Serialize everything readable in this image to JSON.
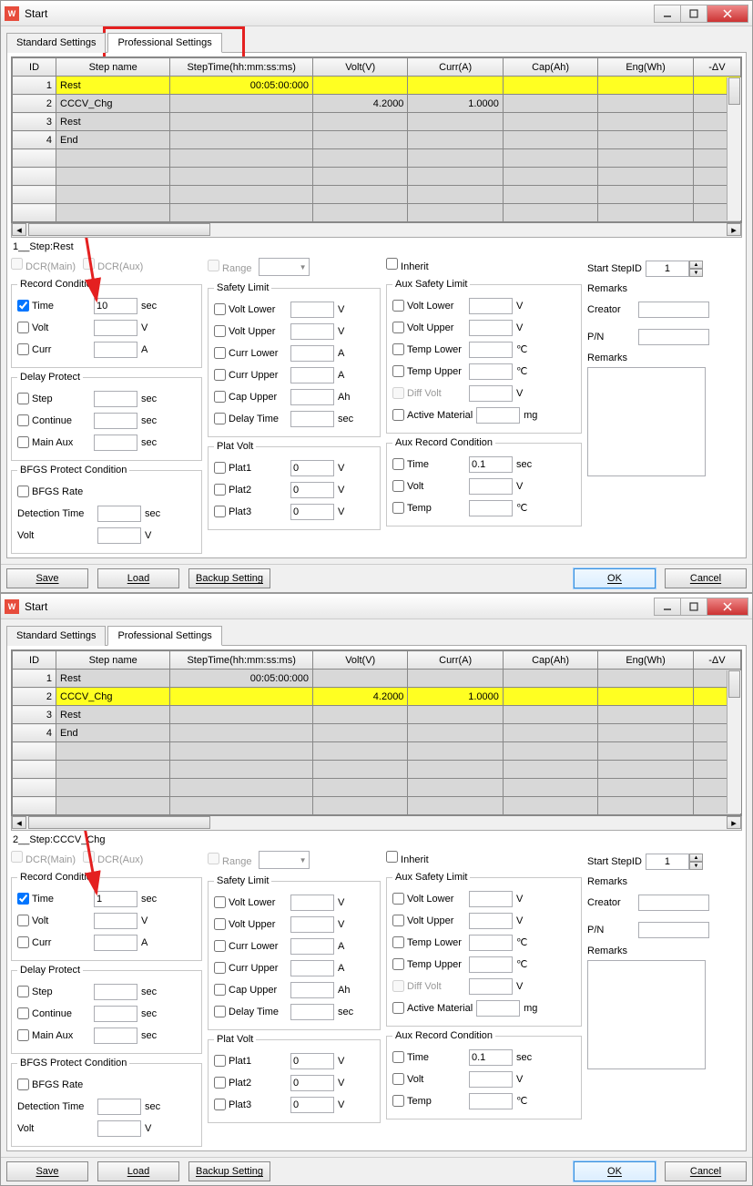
{
  "windows": [
    {
      "title": "Start",
      "tabs": {
        "standard": "Standard Settings",
        "professional": "Professional Settings",
        "active": "professional"
      },
      "highlightTab": true,
      "arrowTo": "time",
      "grid": {
        "headers": [
          "ID",
          "Step name",
          "StepTime(hh:mm:ss:ms)",
          "Volt(V)",
          "Curr(A)",
          "Cap(Ah)",
          "Eng(Wh)",
          "-ΔV"
        ],
        "rows": [
          {
            "id": "1",
            "name": "Rest",
            "time": "00:05:00:000",
            "volt": "",
            "curr": "",
            "cap": "",
            "eng": "",
            "dv": "",
            "sel": true
          },
          {
            "id": "2",
            "name": "CCCV_Chg",
            "time": "",
            "volt": "4.2000",
            "curr": "1.0000",
            "cap": "",
            "eng": "",
            "dv": ""
          },
          {
            "id": "3",
            "name": "Rest",
            "time": "",
            "volt": "",
            "curr": "",
            "cap": "",
            "eng": "",
            "dv": ""
          },
          {
            "id": "4",
            "name": "End",
            "time": "",
            "volt": "",
            "curr": "",
            "cap": "",
            "eng": "",
            "dv": ""
          }
        ]
      },
      "stepTitle": "1__Step:Rest",
      "dcrMain": "DCR(Main)",
      "dcrAux": "DCR(Aux)",
      "rangeLabel": "Range",
      "inheritLabel": "Inherit",
      "record": {
        "legend": "Record Condition",
        "time": "Time",
        "timeVal": "10",
        "timeUnit": "sec",
        "volt": "Volt",
        "voltUnit": "V",
        "curr": "Curr",
        "currUnit": "A"
      },
      "delay": {
        "legend": "Delay Protect",
        "step": "Step",
        "cont": "Continue",
        "main": "Main Aux",
        "unit": "sec"
      },
      "bfgs": {
        "legend": "BFGS Protect Condition",
        "rate": "BFGS Rate",
        "det": "Detection Time",
        "detUnit": "sec",
        "volt": "Volt",
        "voltUnit": "V"
      },
      "safety": {
        "legend": "Safety Limit",
        "vl": "Volt Lower",
        "vu": "Volt Upper",
        "cl": "Curr Lower",
        "cu": "Curr Upper",
        "cap": "Cap Upper",
        "dt": "Delay Time",
        "V": "V",
        "A": "A",
        "Ah": "Ah",
        "sec": "sec"
      },
      "plat": {
        "legend": "Plat Volt",
        "p1": "Plat1",
        "p2": "Plat2",
        "p3": "Plat3",
        "V": "V",
        "val": "0"
      },
      "aux": {
        "legend": "Aux Safety Limit",
        "vl": "Volt Lower",
        "vu": "Volt Upper",
        "tl": "Temp Lower",
        "tu": "Temp Upper",
        "dv": "Diff Volt",
        "am": "Active Material",
        "V": "V",
        "C": "℃",
        "mg": "mg"
      },
      "auxrec": {
        "legend": "Aux Record Condition",
        "time": "Time",
        "timeVal": "0.1",
        "timeUnit": "sec",
        "volt": "Volt",
        "V": "V",
        "temp": "Temp",
        "C": "℃"
      },
      "start": {
        "label": "Start StepID",
        "val": "1"
      },
      "remarks": {
        "title": "Remarks",
        "creator": "Creator",
        "pn": "P/N",
        "rem": "Remarks"
      },
      "buttons": {
        "save": "Save",
        "load": "Load",
        "backup": "Backup Setting",
        "ok": "OK",
        "cancel": "Cancel"
      }
    },
    {
      "title": "Start",
      "tabs": {
        "standard": "Standard Settings",
        "professional": "Professional Settings",
        "active": "professional"
      },
      "highlightTab": false,
      "arrowTo": "time",
      "grid": {
        "headers": [
          "ID",
          "Step name",
          "StepTime(hh:mm:ss:ms)",
          "Volt(V)",
          "Curr(A)",
          "Cap(Ah)",
          "Eng(Wh)",
          "-ΔV"
        ],
        "rows": [
          {
            "id": "1",
            "name": "Rest",
            "time": "00:05:00:000",
            "volt": "",
            "curr": "",
            "cap": "",
            "eng": "",
            "dv": ""
          },
          {
            "id": "2",
            "name": "CCCV_Chg",
            "time": "",
            "volt": "4.2000",
            "curr": "1.0000",
            "cap": "",
            "eng": "",
            "dv": "",
            "sel": true
          },
          {
            "id": "3",
            "name": "Rest",
            "time": "",
            "volt": "",
            "curr": "",
            "cap": "",
            "eng": "",
            "dv": ""
          },
          {
            "id": "4",
            "name": "End",
            "time": "",
            "volt": "",
            "curr": "",
            "cap": "",
            "eng": "",
            "dv": ""
          }
        ]
      },
      "stepTitle": "2__Step:CCCV_Chg",
      "dcrMain": "DCR(Main)",
      "dcrAux": "DCR(Aux)",
      "rangeLabel": "Range",
      "inheritLabel": "Inherit",
      "record": {
        "legend": "Record Condition",
        "time": "Time",
        "timeVal": "1",
        "timeUnit": "sec",
        "volt": "Volt",
        "voltUnit": "V",
        "curr": "Curr",
        "currUnit": "A"
      },
      "delay": {
        "legend": "Delay Protect",
        "step": "Step",
        "cont": "Continue",
        "main": "Main Aux",
        "unit": "sec"
      },
      "bfgs": {
        "legend": "BFGS Protect Condition",
        "rate": "BFGS Rate",
        "det": "Detection Time",
        "detUnit": "sec",
        "volt": "Volt",
        "voltUnit": "V"
      },
      "safety": {
        "legend": "Safety Limit",
        "vl": "Volt Lower",
        "vu": "Volt Upper",
        "cl": "Curr Lower",
        "cu": "Curr Upper",
        "cap": "Cap Upper",
        "dt": "Delay Time",
        "V": "V",
        "A": "A",
        "Ah": "Ah",
        "sec": "sec"
      },
      "plat": {
        "legend": "Plat Volt",
        "p1": "Plat1",
        "p2": "Plat2",
        "p3": "Plat3",
        "V": "V",
        "val": "0"
      },
      "aux": {
        "legend": "Aux Safety Limit",
        "vl": "Volt Lower",
        "vu": "Volt Upper",
        "tl": "Temp Lower",
        "tu": "Temp Upper",
        "dv": "Diff Volt",
        "am": "Active Material",
        "V": "V",
        "C": "℃",
        "mg": "mg"
      },
      "auxrec": {
        "legend": "Aux Record Condition",
        "time": "Time",
        "timeVal": "0.1",
        "timeUnit": "sec",
        "volt": "Volt",
        "V": "V",
        "temp": "Temp",
        "C": "℃"
      },
      "start": {
        "label": "Start StepID",
        "val": "1"
      },
      "remarks": {
        "title": "Remarks",
        "creator": "Creator",
        "pn": "P/N",
        "rem": "Remarks"
      },
      "buttons": {
        "save": "Save",
        "load": "Load",
        "backup": "Backup Setting",
        "ok": "OK",
        "cancel": "Cancel"
      }
    }
  ]
}
